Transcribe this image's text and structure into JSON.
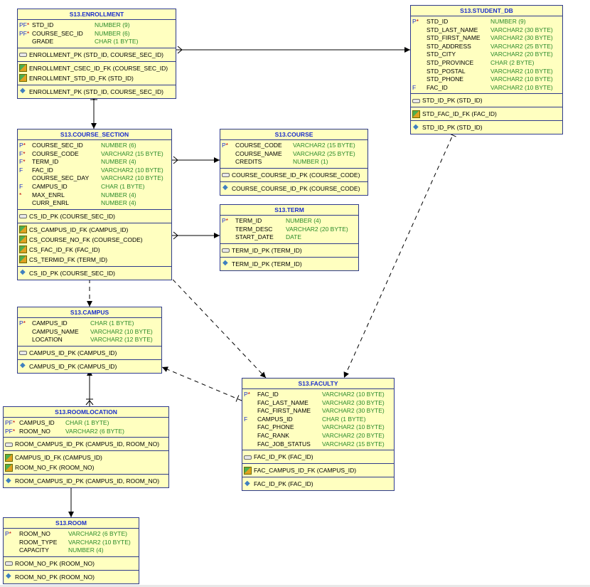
{
  "entities": [
    {
      "id": "enrollment",
      "title": "S13.ENROLLMENT",
      "columns": [
        {
          "flag": "PF",
          "req": "*",
          "name": "STD_ID",
          "type": "NUMBER (9)"
        },
        {
          "flag": "PF",
          "req": "*",
          "name": "COURSE_SEC_ID",
          "type": "NUMBER (6)"
        },
        {
          "flag": "",
          "req": "",
          "name": "GRADE",
          "type": "CHAR (1 BYTE)"
        }
      ],
      "pks": [
        "ENROLLMENT_PK (STD_ID, COURSE_SEC_ID)"
      ],
      "fks": [
        "ENROLLMENT_CSEC_ID_FK (COURSE_SEC_ID)",
        "ENROLLMENT_STD_ID_FK (STD_ID)"
      ],
      "idx": [
        "ENROLLMENT_PK (STD_ID, COURSE_SEC_ID)"
      ]
    },
    {
      "id": "student",
      "title": "S13.STUDENT_DB",
      "columns": [
        {
          "flag": "P",
          "req": "*",
          "name": "STD_ID",
          "type": "NUMBER (9)"
        },
        {
          "flag": "",
          "req": "",
          "name": "STD_LAST_NAME",
          "type": "VARCHAR2 (30 BYTE)"
        },
        {
          "flag": "",
          "req": "",
          "name": "STD_FIRST_NAME",
          "type": "VARCHAR2 (30 BYTE)"
        },
        {
          "flag": "",
          "req": "",
          "name": "STD_ADDRESS",
          "type": "VARCHAR2 (25 BYTE)"
        },
        {
          "flag": "",
          "req": "",
          "name": "STD_CITY",
          "type": "VARCHAR2 (20 BYTE)"
        },
        {
          "flag": "",
          "req": "",
          "name": "STD_PROVINCE",
          "type": "CHAR (2 BYTE)"
        },
        {
          "flag": "",
          "req": "",
          "name": "STD_POSTAL",
          "type": "VARCHAR2 (10 BYTE)"
        },
        {
          "flag": "",
          "req": "",
          "name": "STD_PHONE",
          "type": "VARCHAR2 (10 BYTE)"
        },
        {
          "flag": "F",
          "req": "",
          "name": "FAC_ID",
          "type": "VARCHAR2 (10 BYTE)"
        }
      ],
      "pks": [
        "STD_ID_PK (STD_ID)"
      ],
      "fks": [
        "STD_FAC_ID_FK (FAC_ID)"
      ],
      "idx": [
        "STD_ID_PK (STD_ID)"
      ]
    },
    {
      "id": "course_section",
      "title": "S13.COURSE_SECTION",
      "columns": [
        {
          "flag": "P",
          "req": "*",
          "name": "COURSE_SEC_ID",
          "type": "NUMBER (6)"
        },
        {
          "flag": "F",
          "req": "*",
          "name": "COURSE_CODE",
          "type": "VARCHAR2 (15 BYTE)"
        },
        {
          "flag": "F",
          "req": "*",
          "name": "TERM_ID",
          "type": "NUMBER (4)"
        },
        {
          "flag": "F",
          "req": "",
          "name": "FAC_ID",
          "type": "VARCHAR2 (10 BYTE)"
        },
        {
          "flag": "",
          "req": "",
          "name": "COURSE_SEC_DAY",
          "type": "VARCHAR2 (10 BYTE)"
        },
        {
          "flag": "F",
          "req": "",
          "name": "CAMPUS_ID",
          "type": "CHAR (1 BYTE)"
        },
        {
          "flag": "",
          "req": "*",
          "name": "MAX_ENRL",
          "type": "NUMBER (4)"
        },
        {
          "flag": "",
          "req": "",
          "name": "CURR_ENRL",
          "type": "NUMBER (4)"
        }
      ],
      "pks": [
        "CS_ID_PK (COURSE_SEC_ID)"
      ],
      "fks": [
        "CS_CAMPUS_ID_FK (CAMPUS_ID)",
        "CS_COURSE_NO_FK (COURSE_CODE)",
        "CS_FAC_ID_FK (FAC_ID)",
        "CS_TERMID_FK (TERM_ID)"
      ],
      "idx": [
        "CS_ID_PK (COURSE_SEC_ID)"
      ]
    },
    {
      "id": "course",
      "title": "S13.COURSE",
      "columns": [
        {
          "flag": "P",
          "req": "*",
          "name": "COURSE_CODE",
          "type": "VARCHAR2 (15 BYTE)"
        },
        {
          "flag": "",
          "req": "",
          "name": "COURSE_NAME",
          "type": "VARCHAR2 (25 BYTE)"
        },
        {
          "flag": "",
          "req": "",
          "name": "CREDITS",
          "type": "NUMBER (1)"
        }
      ],
      "pks": [
        "COURSE_COURSE_ID_PK (COURSE_CODE)"
      ],
      "fks": [],
      "idx": [
        "COURSE_COURSE_ID_PK (COURSE_CODE)"
      ]
    },
    {
      "id": "term",
      "title": "S13.TERM",
      "columns": [
        {
          "flag": "P",
          "req": "*",
          "name": "TERM_ID",
          "type": "NUMBER (4)"
        },
        {
          "flag": "",
          "req": "",
          "name": "TERM_DESC",
          "type": "VARCHAR2 (20 BYTE)"
        },
        {
          "flag": "",
          "req": "",
          "name": "START_DATE",
          "type": "DATE"
        }
      ],
      "pks": [
        "TERM_ID_PK (TERM_ID)"
      ],
      "fks": [],
      "idx": [
        "TERM_ID_PK (TERM_ID)"
      ]
    },
    {
      "id": "campus",
      "title": "S13.CAMPUS",
      "columns": [
        {
          "flag": "P",
          "req": "*",
          "name": "CAMPUS_ID",
          "type": "CHAR (1 BYTE)"
        },
        {
          "flag": "",
          "req": "",
          "name": "CAMPUS_NAME",
          "type": "VARCHAR2 (10 BYTE)"
        },
        {
          "flag": "",
          "req": "",
          "name": "LOCATION",
          "type": "VARCHAR2 (12 BYTE)"
        }
      ],
      "pks": [
        "CAMPUS_ID_PK (CAMPUS_ID)"
      ],
      "fks": [],
      "idx": [
        "CAMPUS_ID_PK (CAMPUS_ID)"
      ]
    },
    {
      "id": "faculty",
      "title": "S13.FACULTY",
      "columns": [
        {
          "flag": "P",
          "req": "*",
          "name": "FAC_ID",
          "type": "VARCHAR2 (10 BYTE)"
        },
        {
          "flag": "",
          "req": "",
          "name": "FAC_LAST_NAME",
          "type": "VARCHAR2 (30 BYTE)"
        },
        {
          "flag": "",
          "req": "",
          "name": "FAC_FIRST_NAME",
          "type": "VARCHAR2 (30 BYTE)"
        },
        {
          "flag": "F",
          "req": "",
          "name": "CAMPUS_ID",
          "type": "CHAR (1 BYTE)"
        },
        {
          "flag": "",
          "req": "",
          "name": "FAC_PHONE",
          "type": "VARCHAR2 (10 BYTE)"
        },
        {
          "flag": "",
          "req": "",
          "name": "FAC_RANK",
          "type": "VARCHAR2 (20 BYTE)"
        },
        {
          "flag": "",
          "req": "",
          "name": "FAC_JOB_STATUS",
          "type": "VARCHAR2 (15 BYTE)"
        }
      ],
      "pks": [
        "FAC_ID_PK (FAC_ID)"
      ],
      "fks": [
        "FAC_CAMPUS_ID_FK (CAMPUS_ID)"
      ],
      "idx": [
        "FAC_ID_PK (FAC_ID)"
      ]
    },
    {
      "id": "roomlocation",
      "title": "S13.ROOMLOCATION",
      "columns": [
        {
          "flag": "PF",
          "req": "*",
          "name": "CAMPUS_ID",
          "type": "CHAR (1 BYTE)"
        },
        {
          "flag": "PF",
          "req": "*",
          "name": "ROOM_NO",
          "type": "VARCHAR2 (6 BYTE)"
        }
      ],
      "pks": [
        "ROOM_CAMPUS_ID_PK (CAMPUS_ID, ROOM_NO)"
      ],
      "fks": [
        "CAMPUS_ID_FK (CAMPUS_ID)",
        "ROOM_NO_FK (ROOM_NO)"
      ],
      "idx": [
        "ROOM_CAMPUS_ID_PK (CAMPUS_ID, ROOM_NO)"
      ]
    },
    {
      "id": "room",
      "title": "S13.ROOM",
      "columns": [
        {
          "flag": "P",
          "req": "*",
          "name": "ROOM_NO",
          "type": "VARCHAR2 (6 BYTE)"
        },
        {
          "flag": "",
          "req": "",
          "name": "ROOM_TYPE",
          "type": "VARCHAR2 (10 BYTE)"
        },
        {
          "flag": "",
          "req": "",
          "name": "CAPACITY",
          "type": "NUMBER (4)"
        }
      ],
      "pks": [
        "ROOM_NO_PK (ROOM_NO)"
      ],
      "fks": [],
      "idx": [
        "ROOM_NO_PK (ROOM_NO)"
      ]
    }
  ],
  "relationships": [
    {
      "from": "enrollment",
      "to": "student",
      "style": "solid"
    },
    {
      "from": "enrollment",
      "to": "course_section",
      "style": "solid"
    },
    {
      "from": "course_section",
      "to": "course",
      "style": "solid"
    },
    {
      "from": "course_section",
      "to": "term",
      "style": "solid"
    },
    {
      "from": "course_section",
      "to": "campus",
      "style": "dashed"
    },
    {
      "from": "course_section",
      "to": "faculty",
      "style": "dashed"
    },
    {
      "from": "student",
      "to": "faculty",
      "style": "dashed"
    },
    {
      "from": "faculty",
      "to": "campus",
      "style": "dashed"
    },
    {
      "from": "roomlocation",
      "to": "campus",
      "style": "solid"
    },
    {
      "from": "roomlocation",
      "to": "room",
      "style": "solid"
    }
  ],
  "colors": {
    "entity_fill": "#ffffc0",
    "border": "#2e3a8c",
    "title": "#1a2dcc",
    "type": "#2a8a2a",
    "required": "#c00000"
  }
}
